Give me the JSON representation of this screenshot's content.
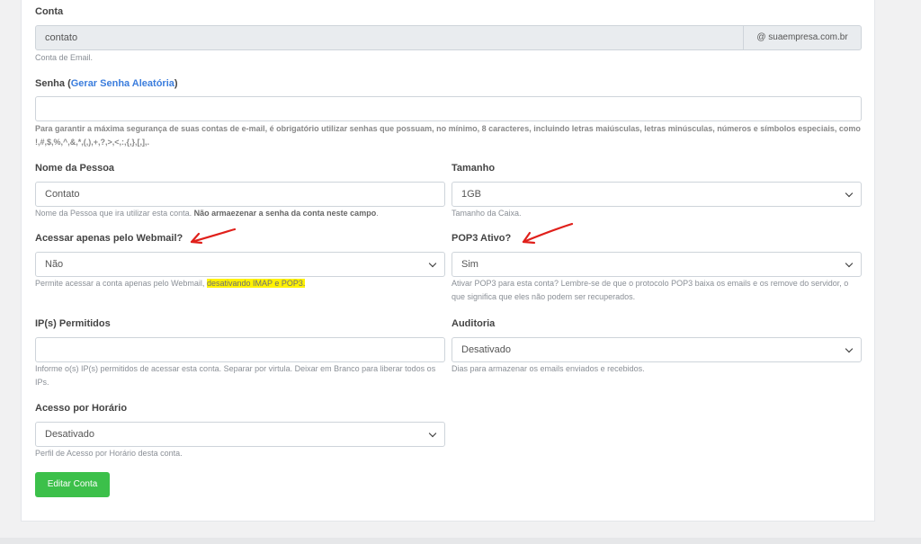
{
  "conta": {
    "label": "Conta",
    "value": "contato",
    "domain": "@ suaempresa.com.br",
    "help": "Conta de Email."
  },
  "senha": {
    "label_prefix": "Senha (",
    "link": "Gerar Senha Aleatória",
    "label_suffix": ")",
    "value": "",
    "help": "Para garantir a máxima segurança de suas contas de e-mail, é obrigatório utilizar senhas que possuam, no mínimo, 8 caracteres, incluindo letras maiúsculas, letras minúsculas, números e símbolos especiais, como !,#,$,%,^,&,*,(,),+,?,>,<,:,{,},[,],."
  },
  "nome": {
    "label": "Nome da Pessoa",
    "value": "Contato",
    "help_plain": "Nome da Pessoa que ira utilizar esta conta. ",
    "help_bold": "Não armaezenar a senha da conta neste campo",
    "help_end": "."
  },
  "tamanho": {
    "label": "Tamanho",
    "value": "1GB",
    "help": "Tamanho da Caixa."
  },
  "webmail": {
    "label": "Acessar apenas pelo Webmail?",
    "value": "Não",
    "help_plain": "Permite acessar a conta apenas pelo Webmail, ",
    "help_highlight": "desativando IMAP e POP3."
  },
  "pop3": {
    "label": "POP3 Ativo?",
    "value": "Sim",
    "help": "Ativar POP3 para esta conta? Lembre-se de que o protocolo POP3 baixa os emails e os remove do servidor, o que significa que eles não podem ser recuperados."
  },
  "ips": {
    "label": "IP(s) Permitidos",
    "value": "",
    "help": "Informe o(s) IP(s) permitidos de acessar esta conta. Separar por virtula. Deixar em Branco para liberar todos os IPs."
  },
  "auditoria": {
    "label": "Auditoria",
    "value": "Desativado",
    "help": "Dias para armazenar os emails enviados e recebidos."
  },
  "horario": {
    "label": "Acesso por Horário",
    "value": "Desativado",
    "help": "Perfil de Acesso por Horário desta conta."
  },
  "submit": {
    "label": "Editar Conta"
  },
  "colors": {
    "annotation": "#e0201b",
    "highlight": "#fff200",
    "button": "#3cc04a",
    "link": "#3b7ddd"
  }
}
